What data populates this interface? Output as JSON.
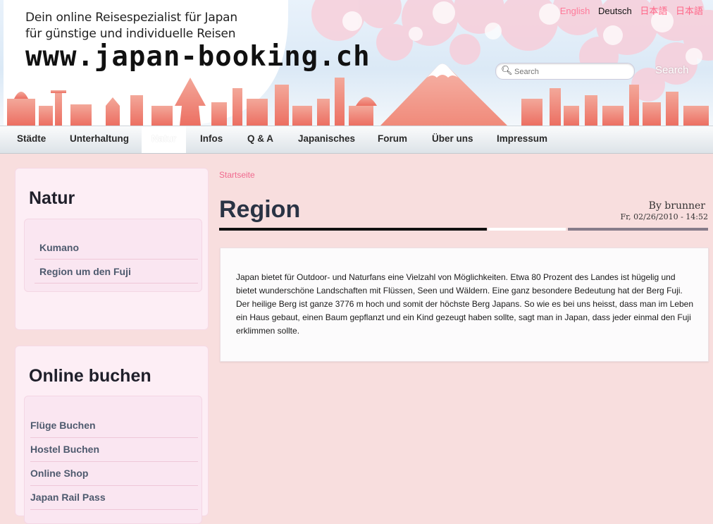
{
  "header": {
    "tagline_1": "Dein online Reisespezialist für Japan",
    "tagline_2": "für günstige und individuelle Reisen",
    "site_url": "www.japan-booking.ch",
    "languages": [
      "English",
      "Deutsch",
      "日本語",
      "日本語"
    ],
    "search": {
      "placeholder": "Search",
      "button_label": "Search"
    }
  },
  "nav": {
    "items": [
      "Städte",
      "Unterhaltung",
      "Natur",
      "Infos",
      "Q & A",
      "Japanisches",
      "Forum",
      "Über uns",
      "Impressum"
    ],
    "active": "Natur"
  },
  "sidebar": {
    "natur": {
      "title": "Natur",
      "links": [
        "Kumano",
        "Region um den Fuji"
      ]
    },
    "booking": {
      "title": "Online buchen",
      "links": [
        "Flüge Buchen",
        "Hostel Buchen",
        "Online Shop",
        "Japan Rail Pass"
      ]
    }
  },
  "main": {
    "breadcrumb": "Startseite",
    "title": "Region",
    "author": "By brunner",
    "date": "Fr, 02/26/2010 - 14:52",
    "body": "Japan bietet für Outdoor- und Naturfans eine Vielzahl von Möglichkeiten. Etwa 80 Prozent des Landes ist hügelig und bietet wunderschöne Landschaften mit Flüssen, Seen und Wäldern. Eine ganz besondere Bedeutung hat der Berg Fuji. Der heilige Berg ist ganze 3776 m hoch und somit der höchste Berg Japans. So wie es bei uns heisst, dass man im Leben ein Haus gebaut, einen Baum gepflanzt und ein Kind gezeugt haben sollte, sagt man in Japan, dass jeder einmal den Fuji erklimmen sollte."
  },
  "colors": {
    "page_bg": "#f8dede",
    "accent_pink": "#f06a8e",
    "skyline": "#f08a7a",
    "blossom": "#f4c4d4"
  }
}
